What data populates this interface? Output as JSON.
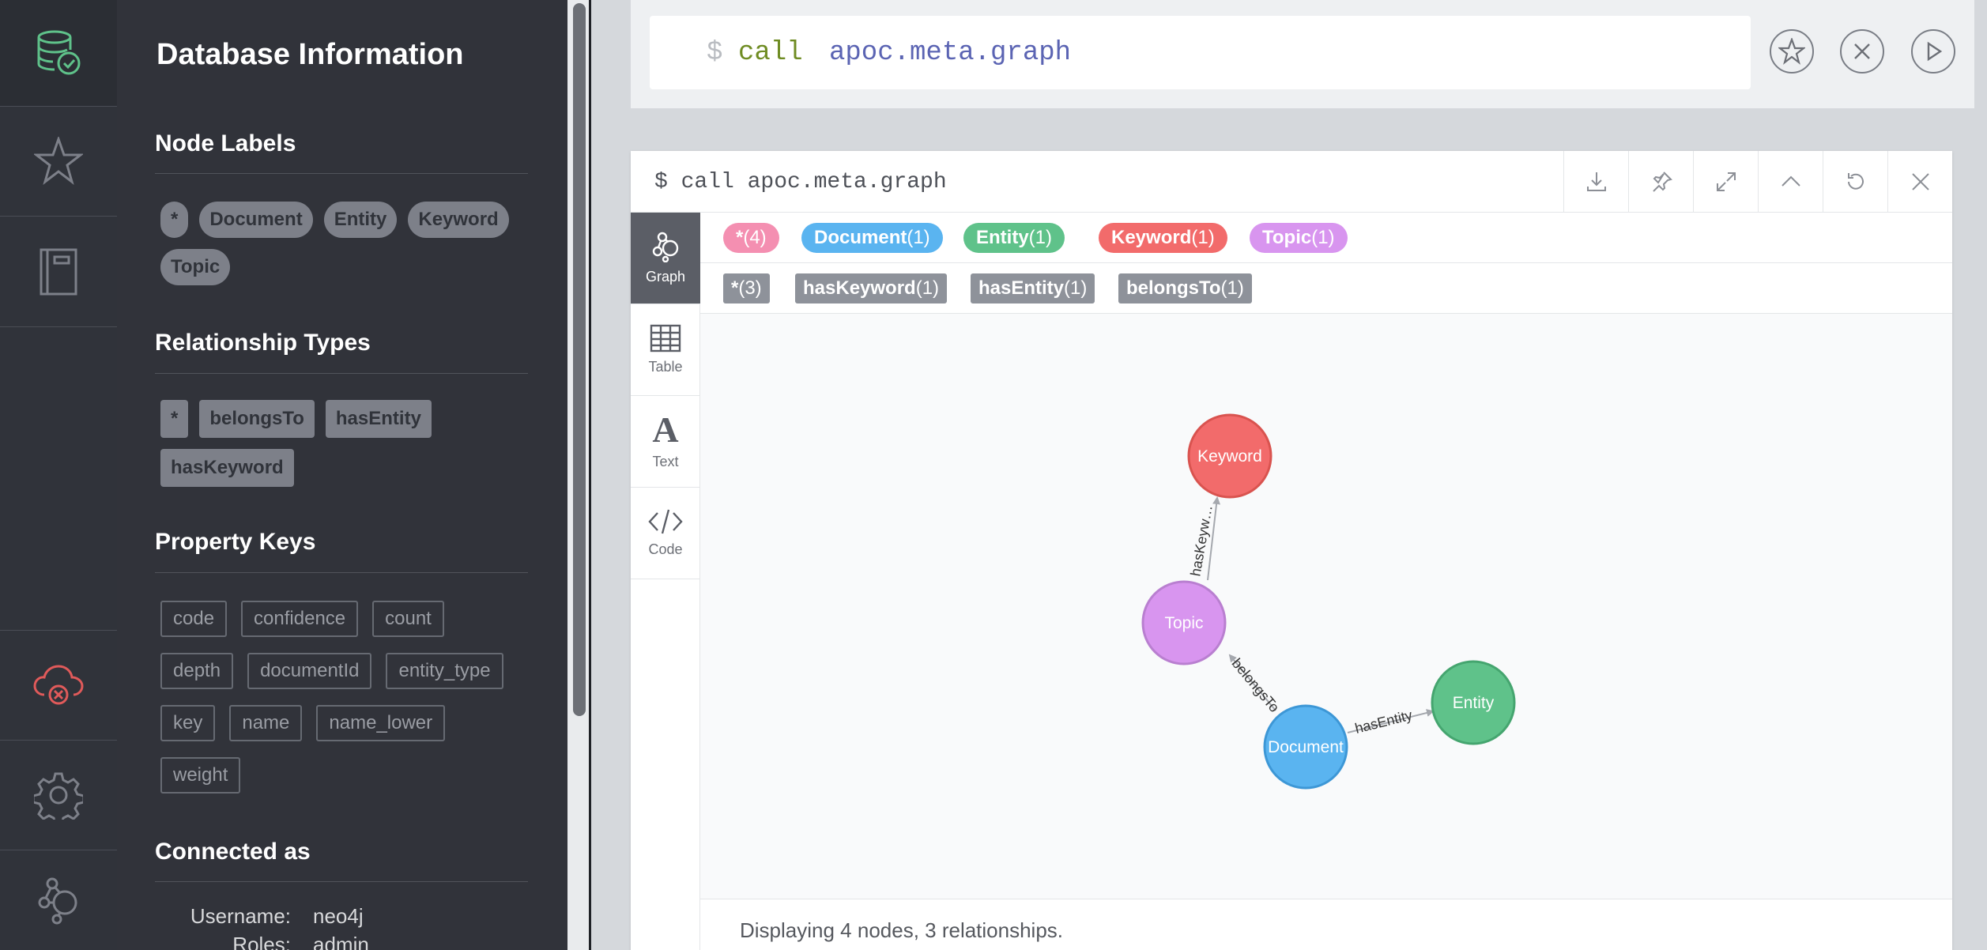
{
  "drawer": {
    "title": "Database Information",
    "node_labels_heading": "Node Labels",
    "node_labels": [
      "*",
      "Document",
      "Entity",
      "Keyword",
      "Topic"
    ],
    "relationship_types_heading": "Relationship Types",
    "relationship_types": [
      "*",
      "belongsTo",
      "hasEntity",
      "hasKeyword"
    ],
    "property_keys_heading": "Property Keys",
    "property_keys": [
      "code",
      "confidence",
      "count",
      "depth",
      "documentId",
      "entity_type",
      "key",
      "name",
      "name_lower",
      "weight"
    ],
    "connected_heading": "Connected as",
    "username_label": "Username:",
    "username": "neo4j",
    "roles_label": "Roles:",
    "roles": "admin"
  },
  "editor": {
    "prompt": "$",
    "keyword": "call",
    "procedure": "apoc.meta.graph"
  },
  "frame": {
    "title": "$ call apoc.meta.graph",
    "tabs": [
      "Graph",
      "Table",
      "Text",
      "Code"
    ],
    "node_legend": [
      {
        "name": "*",
        "count": "(4)",
        "color": "#f48fb1"
      },
      {
        "name": "Document",
        "count": "(1)",
        "color": "#5ab4f0"
      },
      {
        "name": "Entity",
        "count": "(1)",
        "color": "#5fc28a"
      },
      {
        "name": "Keyword",
        "count": "(1)",
        "color": "#f26b6b"
      },
      {
        "name": "Topic",
        "count": "(1)",
        "color": "#d895ef"
      }
    ],
    "rel_legend": [
      {
        "name": "*",
        "count": "(3)"
      },
      {
        "name": "hasKeyword",
        "count": "(1)"
      },
      {
        "name": "hasEntity",
        "count": "(1)"
      },
      {
        "name": "belongsTo",
        "count": "(1)"
      }
    ],
    "graph": {
      "nodes": {
        "keyword": "Keyword",
        "topic": "Topic",
        "document": "Document",
        "entity": "Entity"
      },
      "edges": {
        "has_keyword": "hasKeyw…",
        "belongs_to": "belongsTo",
        "has_entity": "hasEntity"
      },
      "colors": {
        "keyword": "#f26b6b",
        "topic": "#d895ef",
        "document": "#5ab4f0",
        "entity": "#5fc28a"
      }
    },
    "status": "Displaying 4 nodes, 3 relationships."
  },
  "colors": {
    "sidebar_bg": "#30333a",
    "drawer_bg": "#31333a",
    "db_icon_green": "#5fc28a",
    "disconnect_red": "#e05a5a"
  }
}
